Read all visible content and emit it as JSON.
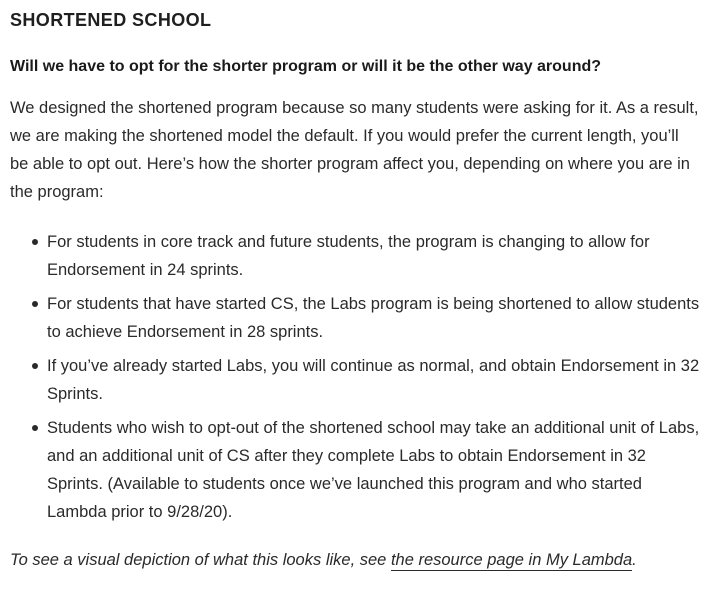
{
  "section_title": "SHORTENED SCHOOL",
  "question": "Will we have to opt for the shorter program or will it be the other way around?",
  "intro": "We designed the shortened program because so many students were asking for it. As a result, we are making the shortened model the default. If you would prefer the current length, you’ll be able to opt out. Here’s how the shorter program affect you, depending on where you are in the program:",
  "bullets": [
    "For students in core track and future students, the program is changing to allow for Endorsement in 24 sprints.",
    "For students that have started CS, the Labs program is being shortened to allow students to achieve Endorsement in 28 sprints.",
    "If you’ve already started Labs, you will continue as normal, and obtain Endorsement in 32 Sprints.",
    "Students who wish to opt-out of the shortened school may take an additional unit of Labs, and an additional unit of CS after they complete Labs to obtain Endorsement in 32 Sprints. (Available to students once we’ve launched this program and who started Lambda prior to 9/28/20)."
  ],
  "footer": {
    "prefix": "To see a visual depiction of what this looks like, see ",
    "link_text": "the resource page in My Lambda",
    "suffix": "."
  }
}
